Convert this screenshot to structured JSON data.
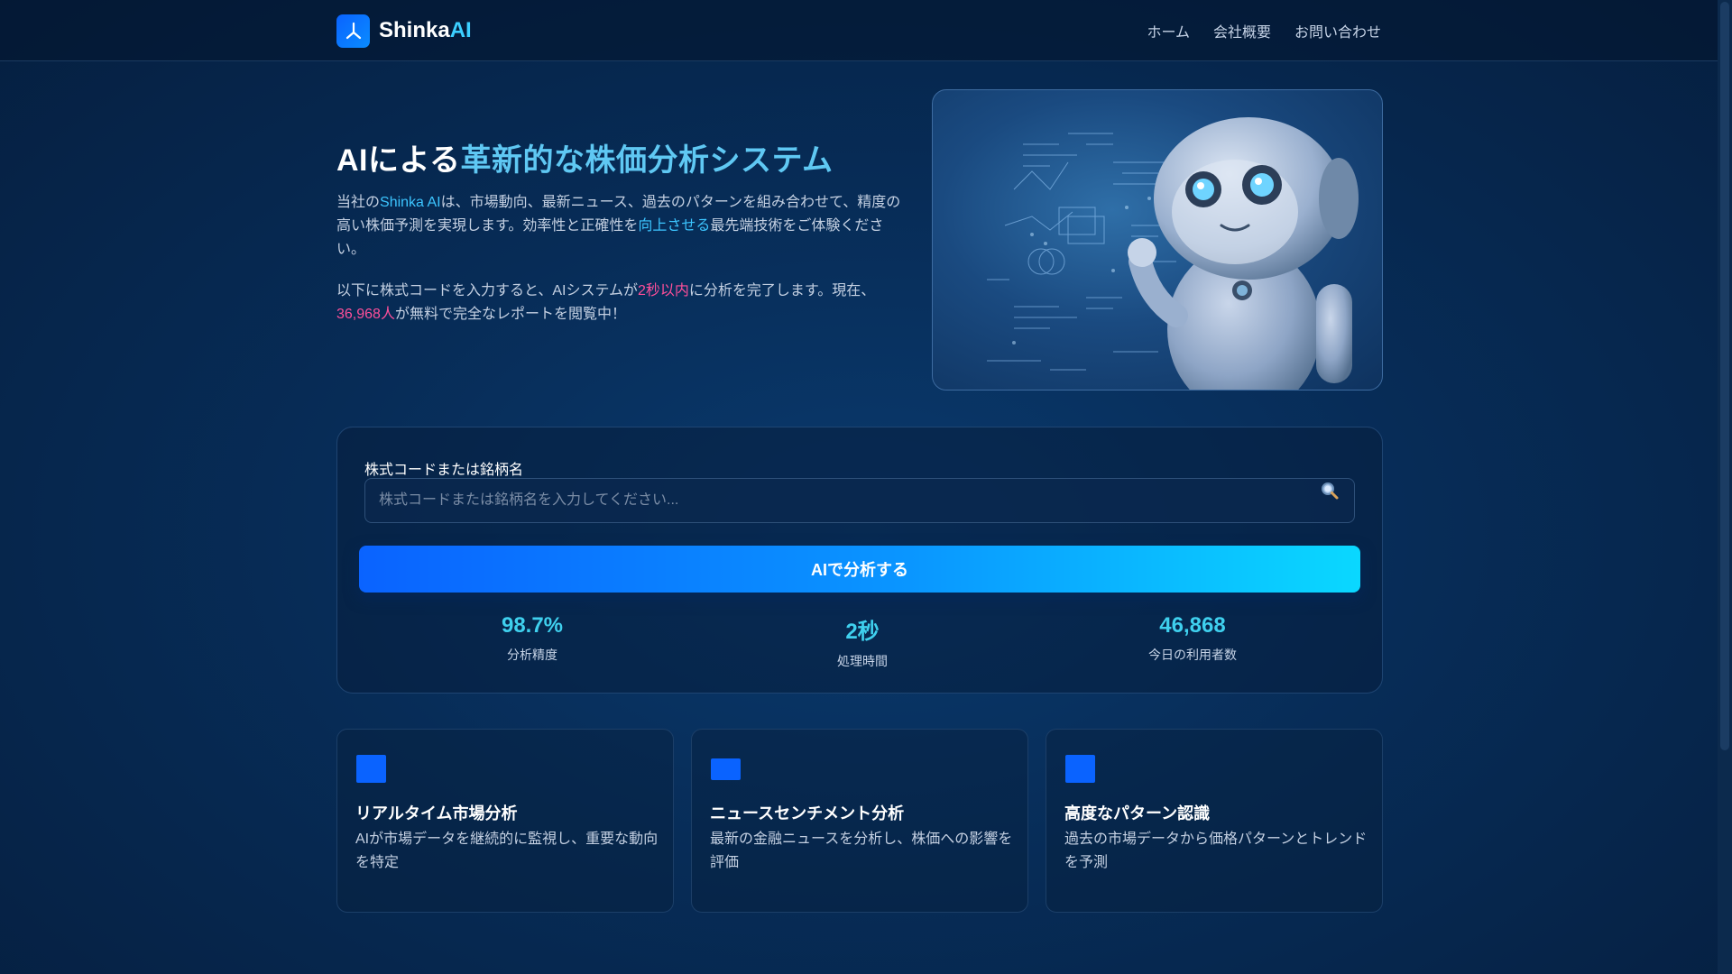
{
  "brand": {
    "name": "Shinka",
    "name_accent": "AI"
  },
  "nav": [
    {
      "label": "ホーム"
    },
    {
      "label": "会社概要"
    },
    {
      "label": "お問い合わせ"
    }
  ],
  "hero": {
    "title_plain": "AIによる",
    "title_accent": "革新的な株価分析システム",
    "p1": {
      "a": "当社の",
      "brand": "Shinka AI",
      "b": "は、市場動向、最新ニュース、過去のパターンを組み合わせて、精度の高い株価予測を実現します。効率性と正確性を",
      "accent": "向上させる",
      "c": "最先端技術をご体験ください。"
    },
    "p2": {
      "a": "以下に株式コードを入力すると、AIシステムが",
      "time": "2秒以内",
      "b": "に分析を完了します。現在、",
      "count": "36,968人",
      "c": "が無料で完全なレポートを閲覧中！"
    }
  },
  "search": {
    "label": "株式コードまたは銘柄名",
    "placeholder": "株式コードまたは銘柄名を入力してください...",
    "value": "",
    "icon": "search-icon",
    "button_label": "AIで分析する"
  },
  "stats": [
    {
      "value": "98.7%",
      "label": "分析精度"
    },
    {
      "value": "2秒",
      "label": "処理時間"
    },
    {
      "value": "46,868",
      "label": "今日の利用者数"
    }
  ],
  "features": [
    {
      "title": "リアルタイム市場分析",
      "desc": "AIが市場データを継続的に監視し、重要な動向を特定"
    },
    {
      "title": "ニュースセンチメント分析",
      "desc": "最新の金融ニュースを分析し、株価への影響を評価"
    },
    {
      "title": "高度なパターン認識",
      "desc": "過去の市場データから価格パターンとトレンドを予測"
    }
  ],
  "colors": {
    "accent_blue": "#0a63ff",
    "accent_cyan": "#3cc5ff",
    "highlight_pink": "#ff4f9a",
    "background": "#072c57"
  }
}
